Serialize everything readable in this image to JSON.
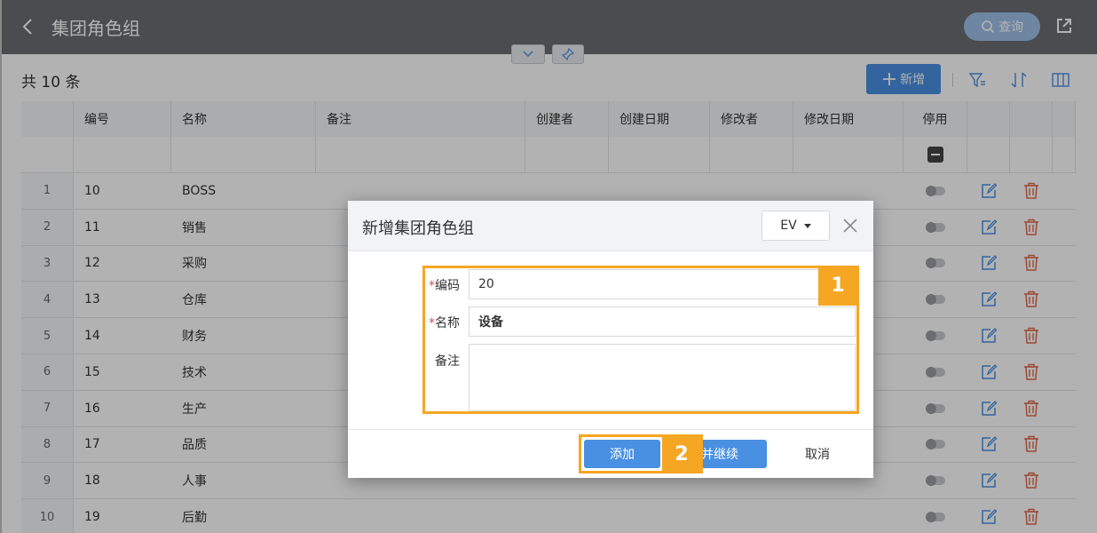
{
  "header": {
    "title": "集团角色组",
    "query_label": "查询"
  },
  "toolbar": {
    "count_label": "共 10 条",
    "add_label": "新增"
  },
  "table": {
    "columns": {
      "code": "编号",
      "name": "名称",
      "note": "备注",
      "creator": "创建者",
      "created": "创建日期",
      "modifier": "修改者",
      "modified": "修改日期",
      "disabled": "停用"
    },
    "rows": [
      {
        "idx": "1",
        "code": "10",
        "name": "BOSS"
      },
      {
        "idx": "2",
        "code": "11",
        "name": "销售"
      },
      {
        "idx": "3",
        "code": "12",
        "name": "采购"
      },
      {
        "idx": "4",
        "code": "13",
        "name": "仓库"
      },
      {
        "idx": "5",
        "code": "14",
        "name": "财务"
      },
      {
        "idx": "6",
        "code": "15",
        "name": "技术"
      },
      {
        "idx": "7",
        "code": "16",
        "name": "生产"
      },
      {
        "idx": "8",
        "code": "17",
        "name": "品质"
      },
      {
        "idx": "9",
        "code": "18",
        "name": "人事"
      },
      {
        "idx": "10",
        "code": "19",
        "name": "后勤"
      }
    ]
  },
  "dialog": {
    "title": "新增集团角色组",
    "language": "EV",
    "fields": {
      "code_label": "编码",
      "code_value": "20",
      "name_label": "名称",
      "name_value": "设备",
      "note_label": "备注",
      "note_value": ""
    },
    "required_mark": "*",
    "buttons": {
      "add": "添加",
      "add_continue": "添加并继续",
      "cancel": "取消"
    },
    "callouts": {
      "one": "1",
      "two": "2"
    }
  },
  "colors": {
    "header_bg": "#6b6e73",
    "primary": "#4a90e2",
    "highlight": "#f5a623",
    "delete_red": "#e06a4b"
  }
}
